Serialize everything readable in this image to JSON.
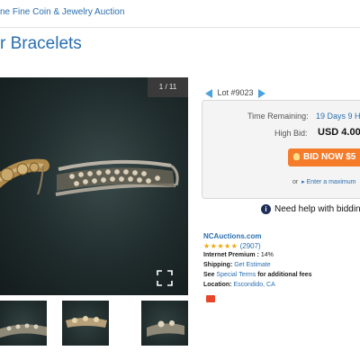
{
  "header": {
    "breadcrumb": "ne Fine Coin & Jewelry Auction",
    "title": "r Bracelets"
  },
  "gallery": {
    "counter": "1 / 11",
    "thumbnails": [
      "thumb-1",
      "thumb-2",
      "thumb-3"
    ]
  },
  "lot": {
    "label": "Lot #9023"
  },
  "bid": {
    "time_label": "Time Remaining:",
    "time_value": "19 Days 9 H",
    "high_label": "High Bid:",
    "high_value": "USD 4.00",
    "button_label": "BID NOW $5",
    "or_text": "or",
    "max_link": "Enter a maximum"
  },
  "help": {
    "text": "Need help with bidding"
  },
  "seller": {
    "name": "NCAuctions.com",
    "stars": "★★★★★",
    "rating_fraction": 1.0,
    "reviews": "(2907)",
    "premium_label": "Internet Premium :",
    "premium_value": "14%",
    "shipping_label": "Shipping:",
    "shipping_link": "Get Estimate",
    "terms_prefix": "See",
    "terms_link": "Special Terms",
    "terms_suffix": "for additional fees",
    "location_label": "Location:",
    "location_value": "Escondido, CA"
  },
  "colors": {
    "link": "#2a6fb0",
    "bid_button": "#f47c2a",
    "stars": "#f0a500",
    "photo_bg": "#1f2b2c"
  }
}
